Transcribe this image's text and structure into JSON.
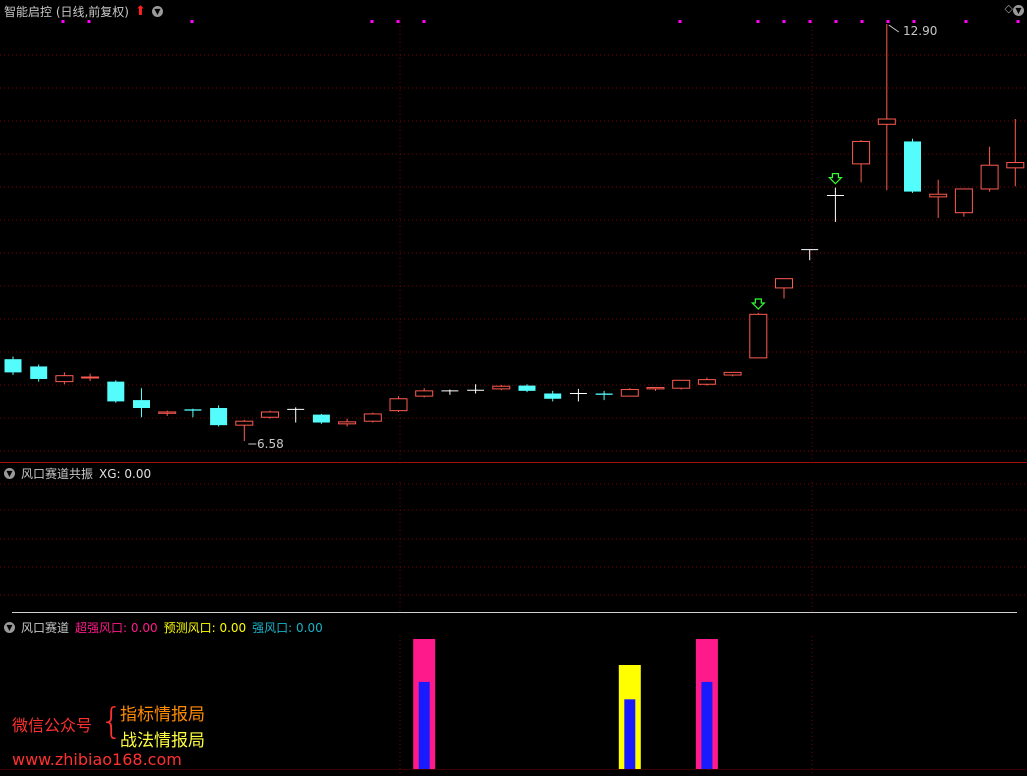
{
  "main_panel": {
    "title": "智能启控 (日线,前复权)",
    "arrow_icon": "red-up-arrow",
    "high_label": "12.90",
    "low_label": "6.58"
  },
  "panel2": {
    "title": "风口赛道共振",
    "value_text": "XG: 0.00"
  },
  "panel3": {
    "title": "风口赛道",
    "items": [
      {
        "label": "超强风口: 0.00",
        "color": "#ff1a8c"
      },
      {
        "label": "预测风口: 0.00",
        "color": "#ffff00"
      },
      {
        "label": "强风口: 0.00",
        "color": "#19b3c8"
      }
    ]
  },
  "watermark": {
    "wechat": "微信公众号",
    "line1": "指标情报局",
    "line2": "战法情报局",
    "url": "www.zhibiao168.com"
  },
  "colors": {
    "up": "#ff5a50",
    "down": "#54fcfc",
    "grid": "#7a0000",
    "magenta": "#ff00ff"
  },
  "chart_data": {
    "type": "candlestick",
    "y_labels": {
      "high": 12.9,
      "low": 6.58
    },
    "candles": [
      {
        "o": 7.82,
        "h": 7.86,
        "c": 7.62,
        "l": 7.58
      },
      {
        "o": 7.71,
        "h": 7.74,
        "c": 7.52,
        "l": 7.48
      },
      {
        "o": 7.48,
        "h": 7.62,
        "c": 7.57,
        "l": 7.44
      },
      {
        "o": 7.54,
        "h": 7.6,
        "c": 7.55,
        "l": 7.49
      },
      {
        "o": 7.48,
        "h": 7.5,
        "c": 7.18,
        "l": 7.16
      },
      {
        "o": 7.2,
        "h": 7.38,
        "c": 7.08,
        "l": 6.94
      },
      {
        "o": 7.0,
        "h": 7.04,
        "c": 7.02,
        "l": 6.96
      },
      {
        "o": 7.06,
        "h": 7.07,
        "c": 7.04,
        "l": 6.94
      },
      {
        "o": 7.08,
        "h": 7.12,
        "c": 6.82,
        "l": 6.8
      },
      {
        "o": 6.82,
        "h": 6.9,
        "c": 6.88,
        "l": 6.58
      },
      {
        "o": 6.94,
        "h": 7.04,
        "c": 7.02,
        "l": 6.92
      },
      {
        "o": 7.06,
        "h": 7.09,
        "c": 7.06,
        "l": 6.86
      },
      {
        "o": 6.98,
        "h": 6.99,
        "c": 6.86,
        "l": 6.84
      },
      {
        "o": 6.84,
        "h": 6.92,
        "c": 6.87,
        "l": 6.8
      },
      {
        "o": 6.88,
        "h": 7.01,
        "c": 6.99,
        "l": 6.86
      },
      {
        "o": 7.04,
        "h": 7.26,
        "c": 7.22,
        "l": 7.02
      },
      {
        "o": 7.26,
        "h": 7.38,
        "c": 7.34,
        "l": 7.24
      },
      {
        "o": 7.34,
        "h": 7.36,
        "c": 7.34,
        "l": 7.28
      },
      {
        "o": 7.35,
        "h": 7.44,
        "c": 7.35,
        "l": 7.3
      },
      {
        "o": 7.37,
        "h": 7.43,
        "c": 7.41,
        "l": 7.35
      },
      {
        "o": 7.42,
        "h": 7.44,
        "c": 7.34,
        "l": 7.32
      },
      {
        "o": 7.3,
        "h": 7.34,
        "c": 7.22,
        "l": 7.18
      },
      {
        "o": 7.3,
        "h": 7.37,
        "c": 7.3,
        "l": 7.18
      },
      {
        "o": 7.3,
        "h": 7.34,
        "c": 7.28,
        "l": 7.2
      },
      {
        "o": 7.26,
        "h": 7.38,
        "c": 7.36,
        "l": 7.26
      },
      {
        "o": 7.37,
        "h": 7.39,
        "c": 7.39,
        "l": 7.34
      },
      {
        "o": 7.38,
        "h": 7.48,
        "c": 7.5,
        "l": 7.36
      },
      {
        "o": 7.44,
        "h": 7.54,
        "c": 7.51,
        "l": 7.42
      },
      {
        "o": 7.58,
        "h": 7.62,
        "c": 7.62,
        "l": 7.56
      },
      {
        "o": 7.84,
        "h": 8.52,
        "c": 8.5,
        "l": 7.84
      },
      {
        "o": 8.9,
        "h": 9.04,
        "c": 9.04,
        "l": 8.74
      },
      {
        "o": 9.48,
        "h": 9.48,
        "c": 9.48,
        "l": 9.32
      },
      {
        "o": 10.3,
        "h": 10.42,
        "c": 10.3,
        "l": 9.9
      },
      {
        "o": 10.78,
        "h": 11.14,
        "c": 11.12,
        "l": 10.5
      },
      {
        "o": 11.38,
        "h": 12.9,
        "c": 11.46,
        "l": 10.38
      },
      {
        "o": 11.12,
        "h": 11.16,
        "c": 10.36,
        "l": 10.34
      },
      {
        "o": 10.28,
        "h": 10.54,
        "c": 10.32,
        "l": 9.96
      },
      {
        "o": 10.04,
        "h": 10.4,
        "c": 10.4,
        "l": 9.98
      },
      {
        "o": 10.4,
        "h": 11.04,
        "c": 10.76,
        "l": 10.36
      },
      {
        "o": 10.72,
        "h": 11.46,
        "c": 10.8,
        "l": 10.44
      }
    ],
    "buy_signal_indices": [
      29,
      32
    ],
    "panel3_bars": [
      {
        "index": 16,
        "series": "超强风口",
        "outer": 1.0,
        "inner": 0.67
      },
      {
        "index": 24,
        "series": "预测风口",
        "outer": 0.8,
        "inner": 0.67
      },
      {
        "index": 27,
        "series": "超强风口",
        "outer": 1.0,
        "inner": 0.67
      }
    ]
  }
}
